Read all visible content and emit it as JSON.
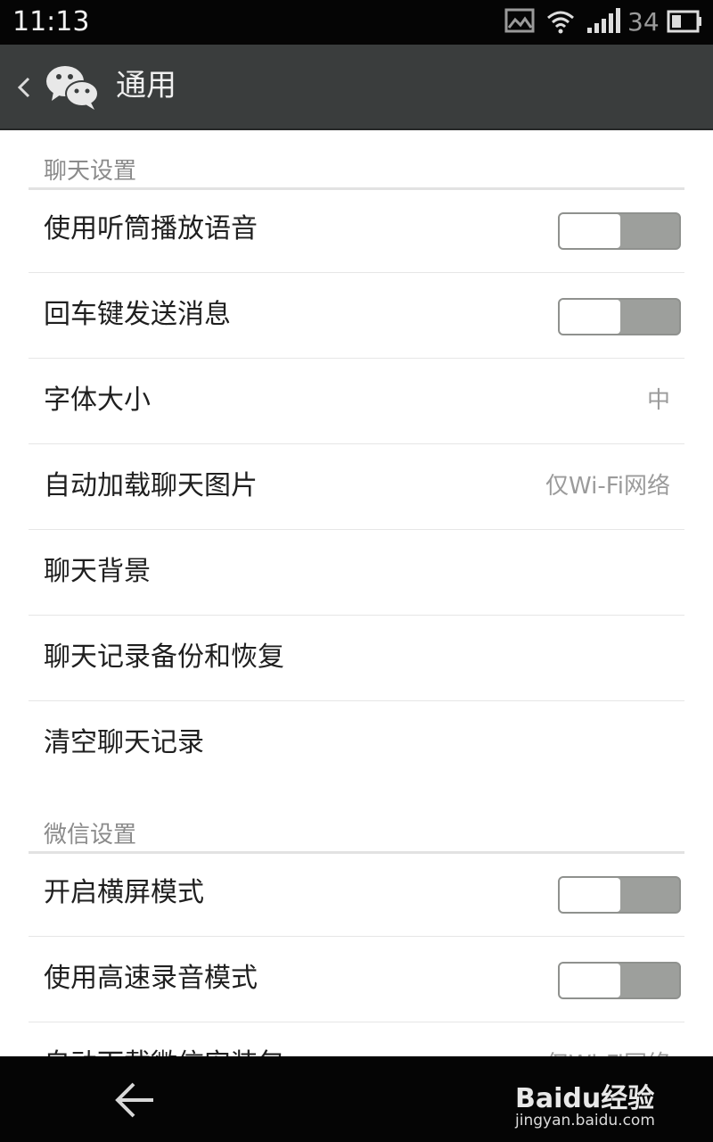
{
  "status_bar": {
    "time": "11:13",
    "battery_percent": "34",
    "icons": [
      "image-notification-icon",
      "wifi-icon",
      "signal-icon",
      "battery-icon"
    ]
  },
  "action_bar": {
    "title": "通用",
    "back_icon": "chevron-left-icon",
    "logo_icon": "wechat-logo-icon"
  },
  "sections": {
    "chat": {
      "header": "聊天设置",
      "items": [
        {
          "label": "使用听筒播放语音",
          "type": "toggle",
          "on": false
        },
        {
          "label": "回车键发送消息",
          "type": "toggle",
          "on": false
        },
        {
          "label": "字体大小",
          "type": "value",
          "value": "中"
        },
        {
          "label": "自动加载聊天图片",
          "type": "value",
          "value": "仅Wi-Fi网络"
        },
        {
          "label": "聊天背景",
          "type": "link"
        },
        {
          "label": "聊天记录备份和恢复",
          "type": "link"
        },
        {
          "label": "清空聊天记录",
          "type": "link"
        }
      ]
    },
    "wechat": {
      "header": "微信设置",
      "items": [
        {
          "label": "开启横屏模式",
          "type": "toggle",
          "on": false
        },
        {
          "label": "使用高速录音模式",
          "type": "toggle",
          "on": false
        },
        {
          "label": "自动下载微信安装包",
          "type": "value",
          "value": "仅Wi-Fi网络"
        }
      ]
    }
  },
  "nav_bar": {
    "back_icon": "back-arrow-icon"
  },
  "watermark": {
    "main": "Baidu经验",
    "sub": "jingyan.baidu.com"
  },
  "colors": {
    "status_bar_bg": "#050505",
    "action_bar_bg": "#3a3d3d",
    "toggle_off": "#9d9f9c",
    "section_header_text": "#8b8b8b"
  }
}
